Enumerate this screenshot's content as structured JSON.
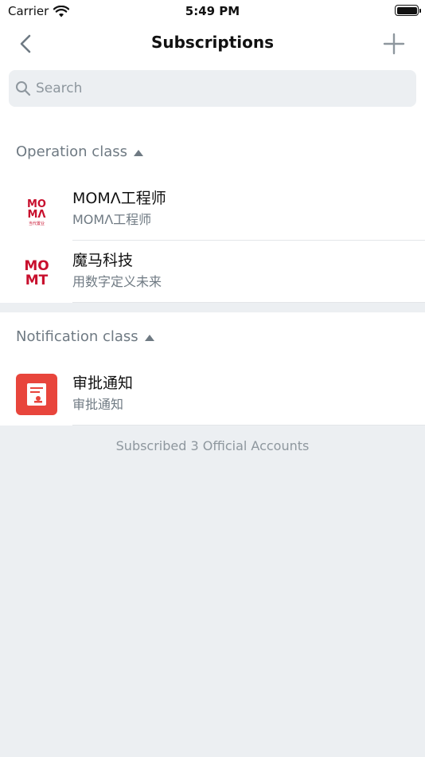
{
  "status": {
    "carrier": "Carrier",
    "time": "5:49 PM"
  },
  "nav": {
    "title": "Subscriptions"
  },
  "search": {
    "placeholder": "Search"
  },
  "sections": [
    {
      "title": "Operation class",
      "items": [
        {
          "name": "MOMΛ工程师",
          "desc": "MOMΛ工程师"
        },
        {
          "name": "魔马科技",
          "desc": "用数字定义未来"
        }
      ]
    },
    {
      "title": "Notification class",
      "items": [
        {
          "name": "审批通知",
          "desc": "审批通知"
        }
      ]
    }
  ],
  "footer": {
    "count_text": "Subscribed 3 Official Accounts"
  },
  "logos": {
    "moma1_line1": "MO",
    "moma1_line2": "MΛ",
    "moma1_sub": "当代置业",
    "moma2_line1": "MO",
    "moma2_line2": "MT"
  },
  "colors": {
    "brand_red": "#c8102e",
    "notify_red": "#e8453c",
    "accent_gray": "#6f7a83"
  },
  "icons": {
    "back": "chevron-left-icon",
    "add": "plus-icon",
    "search": "magnifier-icon",
    "wifi": "wifi-icon",
    "battery": "battery-icon",
    "approval": "document-stamp-icon"
  }
}
